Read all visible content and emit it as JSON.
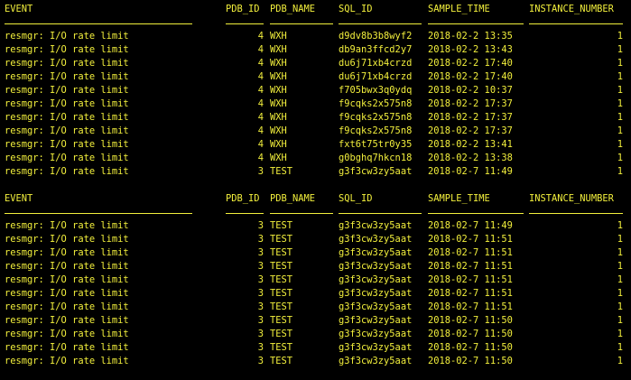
{
  "columns": {
    "event": "EVENT",
    "pdb_id": "PDB_ID",
    "pdb_name": "PDB_NAME",
    "sql_id": "SQL_ID",
    "sample_time": "SAMPLE_TIME",
    "instance_number": "INSTANCE_NUMBER"
  },
  "blocks": [
    {
      "rows": [
        {
          "event": "resmgr: I/O rate limit",
          "pdb_id": "4",
          "pdb_name": "WXH",
          "sql_id": "d9dv8b3b8wyf2",
          "sample_time": "2018-02-2 13:35",
          "instance_number": "1"
        },
        {
          "event": "resmgr: I/O rate limit",
          "pdb_id": "4",
          "pdb_name": "WXH",
          "sql_id": "db9an3ffcd2y7",
          "sample_time": "2018-02-2 13:43",
          "instance_number": "1"
        },
        {
          "event": "resmgr: I/O rate limit",
          "pdb_id": "4",
          "pdb_name": "WXH",
          "sql_id": "du6j71xb4crzd",
          "sample_time": "2018-02-2 17:40",
          "instance_number": "1"
        },
        {
          "event": "resmgr: I/O rate limit",
          "pdb_id": "4",
          "pdb_name": "WXH",
          "sql_id": "du6j71xb4crzd",
          "sample_time": "2018-02-2 17:40",
          "instance_number": "1"
        },
        {
          "event": "resmgr: I/O rate limit",
          "pdb_id": "4",
          "pdb_name": "WXH",
          "sql_id": "f705bwx3q0ydq",
          "sample_time": "2018-02-2 10:37",
          "instance_number": "1"
        },
        {
          "event": "resmgr: I/O rate limit",
          "pdb_id": "4",
          "pdb_name": "WXH",
          "sql_id": "f9cqks2x575n8",
          "sample_time": "2018-02-2 17:37",
          "instance_number": "1"
        },
        {
          "event": "resmgr: I/O rate limit",
          "pdb_id": "4",
          "pdb_name": "WXH",
          "sql_id": "f9cqks2x575n8",
          "sample_time": "2018-02-2 17:37",
          "instance_number": "1"
        },
        {
          "event": "resmgr: I/O rate limit",
          "pdb_id": "4",
          "pdb_name": "WXH",
          "sql_id": "f9cqks2x575n8",
          "sample_time": "2018-02-2 17:37",
          "instance_number": "1"
        },
        {
          "event": "resmgr: I/O rate limit",
          "pdb_id": "4",
          "pdb_name": "WXH",
          "sql_id": "fxt6t75tr0y35",
          "sample_time": "2018-02-2 13:41",
          "instance_number": "1"
        },
        {
          "event": "resmgr: I/O rate limit",
          "pdb_id": "4",
          "pdb_name": "WXH",
          "sql_id": "g0bghq7hkcn18",
          "sample_time": "2018-02-2 13:38",
          "instance_number": "1"
        },
        {
          "event": "resmgr: I/O rate limit",
          "pdb_id": "3",
          "pdb_name": "TEST",
          "sql_id": "g3f3cw3zy5aat",
          "sample_time": "2018-02-7 11:49",
          "instance_number": "1"
        }
      ]
    },
    {
      "rows": [
        {
          "event": "resmgr: I/O rate limit",
          "pdb_id": "3",
          "pdb_name": "TEST",
          "sql_id": "g3f3cw3zy5aat",
          "sample_time": "2018-02-7 11:49",
          "instance_number": "1"
        },
        {
          "event": "resmgr: I/O rate limit",
          "pdb_id": "3",
          "pdb_name": "TEST",
          "sql_id": "g3f3cw3zy5aat",
          "sample_time": "2018-02-7 11:51",
          "instance_number": "1"
        },
        {
          "event": "resmgr: I/O rate limit",
          "pdb_id": "3",
          "pdb_name": "TEST",
          "sql_id": "g3f3cw3zy5aat",
          "sample_time": "2018-02-7 11:51",
          "instance_number": "1"
        },
        {
          "event": "resmgr: I/O rate limit",
          "pdb_id": "3",
          "pdb_name": "TEST",
          "sql_id": "g3f3cw3zy5aat",
          "sample_time": "2018-02-7 11:51",
          "instance_number": "1"
        },
        {
          "event": "resmgr: I/O rate limit",
          "pdb_id": "3",
          "pdb_name": "TEST",
          "sql_id": "g3f3cw3zy5aat",
          "sample_time": "2018-02-7 11:51",
          "instance_number": "1"
        },
        {
          "event": "resmgr: I/O rate limit",
          "pdb_id": "3",
          "pdb_name": "TEST",
          "sql_id": "g3f3cw3zy5aat",
          "sample_time": "2018-02-7 11:51",
          "instance_number": "1"
        },
        {
          "event": "resmgr: I/O rate limit",
          "pdb_id": "3",
          "pdb_name": "TEST",
          "sql_id": "g3f3cw3zy5aat",
          "sample_time": "2018-02-7 11:51",
          "instance_number": "1"
        },
        {
          "event": "resmgr: I/O rate limit",
          "pdb_id": "3",
          "pdb_name": "TEST",
          "sql_id": "g3f3cw3zy5aat",
          "sample_time": "2018-02-7 11:50",
          "instance_number": "1"
        },
        {
          "event": "resmgr: I/O rate limit",
          "pdb_id": "3",
          "pdb_name": "TEST",
          "sql_id": "g3f3cw3zy5aat",
          "sample_time": "2018-02-7 11:50",
          "instance_number": "1"
        },
        {
          "event": "resmgr: I/O rate limit",
          "pdb_id": "3",
          "pdb_name": "TEST",
          "sql_id": "g3f3cw3zy5aat",
          "sample_time": "2018-02-7 11:50",
          "instance_number": "1"
        },
        {
          "event": "resmgr: I/O rate limit",
          "pdb_id": "3",
          "pdb_name": "TEST",
          "sql_id": "g3f3cw3zy5aat",
          "sample_time": "2018-02-7 11:50",
          "instance_number": "1"
        }
      ]
    }
  ],
  "colors": {
    "background": "#000000",
    "text": "#f2ef3c"
  }
}
